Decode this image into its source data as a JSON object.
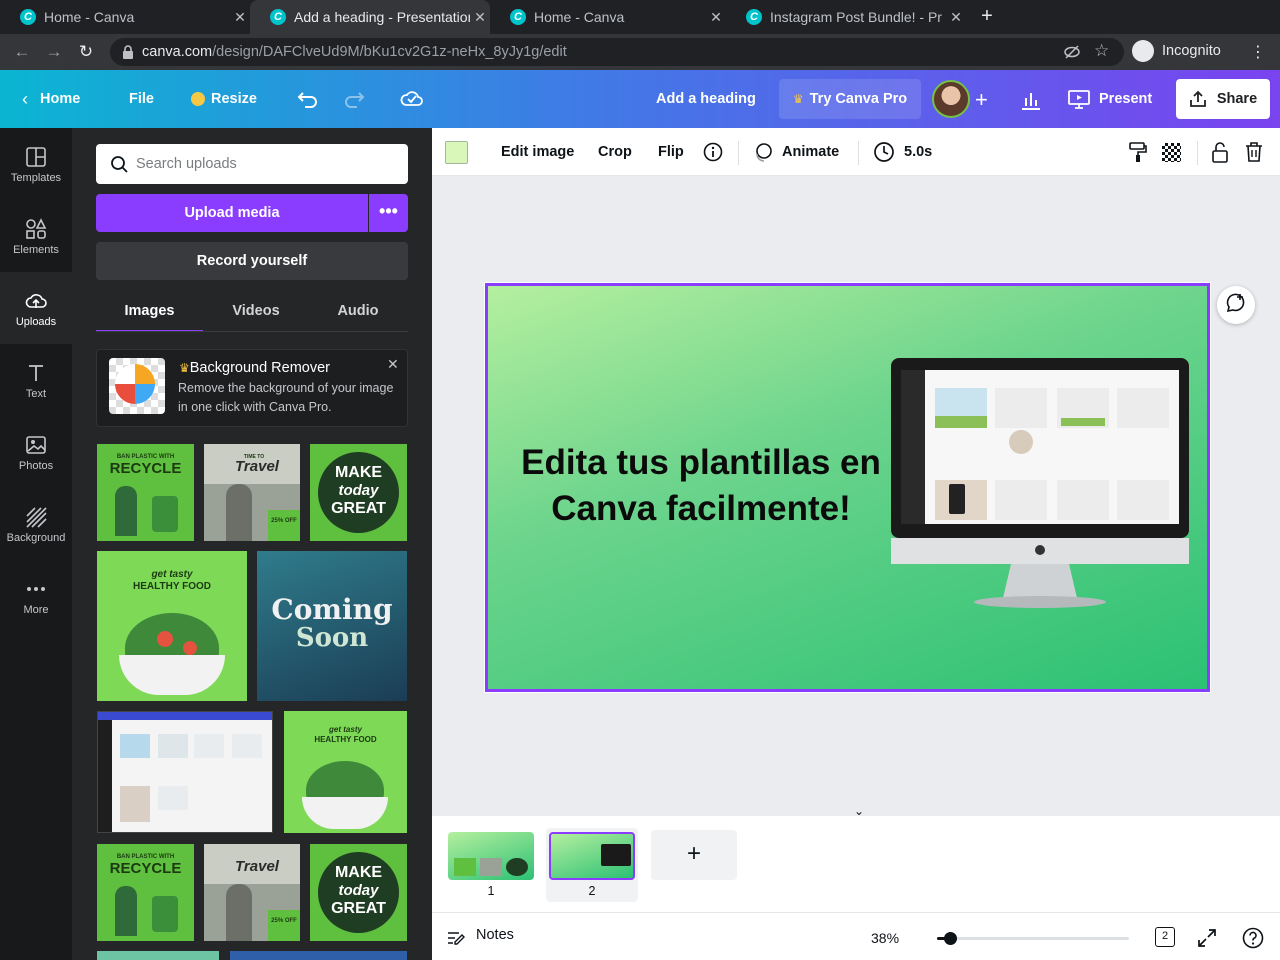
{
  "browser": {
    "tabs": [
      {
        "title": "Home - Canva"
      },
      {
        "title": "Add a heading - Presentation"
      },
      {
        "title": "Home - Canva"
      },
      {
        "title": "Instagram Post Bundle! - Pr"
      }
    ],
    "url_host": "canva.com",
    "url_path": "/design/DAFClveUd9M/bKu1cv2G1z-neHx_8yJy1g/edit",
    "incognito_label": "Incognito"
  },
  "header": {
    "home": "Home",
    "file": "File",
    "resize": "Resize",
    "design_title": "Add a heading",
    "try_pro": "Try Canva Pro",
    "present": "Present",
    "share": "Share"
  },
  "rail": {
    "items": [
      {
        "label": "Templates"
      },
      {
        "label": "Elements"
      },
      {
        "label": "Uploads"
      },
      {
        "label": "Text"
      },
      {
        "label": "Photos"
      },
      {
        "label": "Background"
      },
      {
        "label": "More"
      }
    ]
  },
  "panel": {
    "search_placeholder": "Search uploads",
    "upload_label": "Upload media",
    "record_label": "Record yourself",
    "tabs": [
      {
        "label": "Images"
      },
      {
        "label": "Videos"
      },
      {
        "label": "Audio"
      }
    ],
    "bg_remover": {
      "title": "Background Remover",
      "description": "Remove the background of your image in one click with Canva Pro."
    },
    "thumbs": {
      "recycle_top": "BAN PLASTIC WITH",
      "recycle": "RECYCLE",
      "travel_top": "TIME TO",
      "travel": "Travel",
      "travel_off": "25% OFF",
      "make": "MAKE",
      "today": "today",
      "great": "GREAT",
      "food_top": "get tasty",
      "food": "HEALTHY FOOD",
      "coming": "Coming",
      "soon": "Soon"
    }
  },
  "toolbar": {
    "edit_image": "Edit image",
    "crop": "Crop",
    "flip": "Flip",
    "animate": "Animate",
    "duration": "5.0s",
    "swatch_color": "#d9f7b8"
  },
  "slide": {
    "heading": "Edita tus plantillas en Canva facilmente!"
  },
  "pages": {
    "items": [
      {
        "number": "1"
      },
      {
        "number": "2"
      }
    ],
    "add_symbol": "+"
  },
  "bottom": {
    "notes": "Notes",
    "zoom": "38%",
    "zoom_fraction": 0.07,
    "page_count": "2"
  }
}
